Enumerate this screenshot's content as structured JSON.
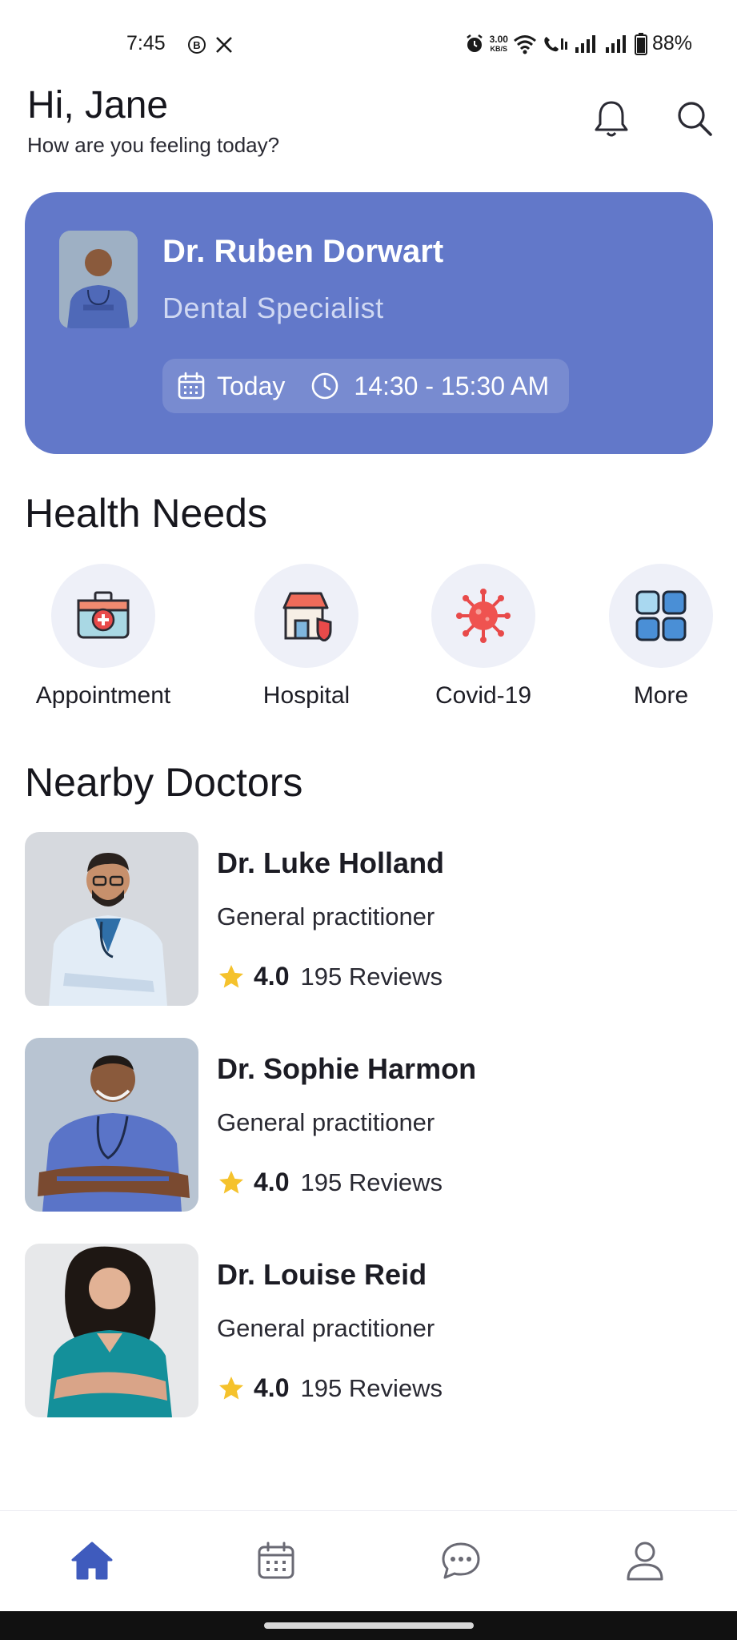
{
  "status_bar": {
    "time": "7:45",
    "speed_value": "3.00",
    "speed_unit": "KB/S",
    "battery": "88%",
    "notification_icons": [
      "b-circle-icon",
      "x-logo-icon"
    ]
  },
  "header": {
    "greeting": "Hi, Jane",
    "subtitle": "How are you feeling today?"
  },
  "appointment": {
    "doctor_name": "Dr. Ruben Dorwart",
    "specialty": "Dental Specialist",
    "date": "Today",
    "time": "14:30 - 15:30 AM",
    "card_color": "#6278c9"
  },
  "health_needs": {
    "title": "Health Needs",
    "items": [
      {
        "label": "Appointment",
        "icon": "first-aid-kit-icon"
      },
      {
        "label": "Hospital",
        "icon": "hospital-icon"
      },
      {
        "label": "Covid-19",
        "icon": "virus-icon"
      },
      {
        "label": "More",
        "icon": "grid-icon"
      }
    ]
  },
  "nearby": {
    "title": "Nearby Doctors",
    "doctors": [
      {
        "name": "Dr. Luke Holland",
        "role": "General practitioner",
        "rating": "4.0",
        "reviews": "195 Reviews"
      },
      {
        "name": "Dr. Sophie Harmon",
        "role": "General practitioner",
        "rating": "4.0",
        "reviews": "195 Reviews"
      },
      {
        "name": "Dr. Louise Reid",
        "role": "General practitioner",
        "rating": "4.0",
        "reviews": "195 Reviews"
      }
    ]
  },
  "bottom_nav": {
    "items": [
      {
        "icon": "home-icon",
        "active": true
      },
      {
        "icon": "calendar-icon",
        "active": false
      },
      {
        "icon": "chat-icon",
        "active": false
      },
      {
        "icon": "profile-icon",
        "active": false
      }
    ],
    "active_color": "#3f5bbd",
    "inactive_color": "#6a6a74"
  },
  "colors": {
    "star": "#f5c22c",
    "accent": "#6278c9"
  }
}
